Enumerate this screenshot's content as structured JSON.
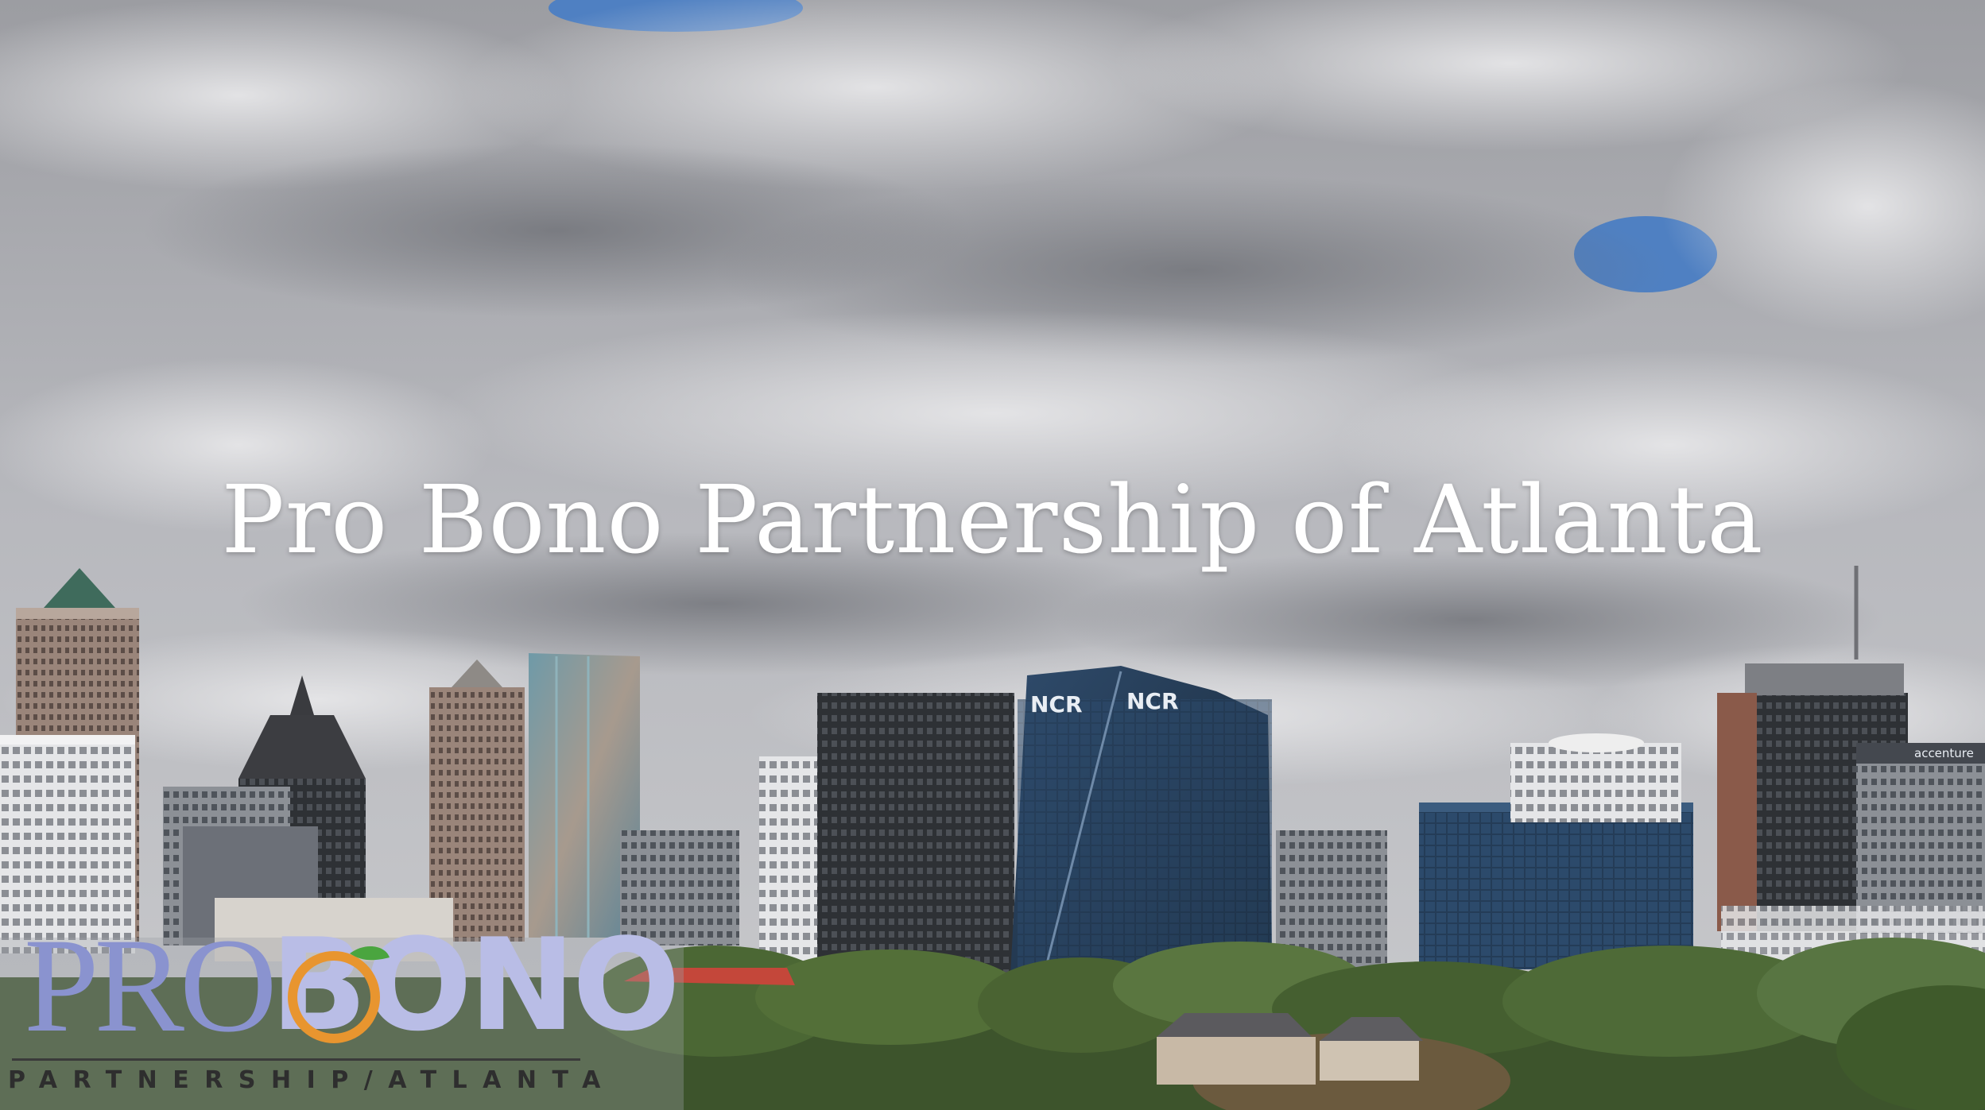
{
  "title": "Pro Bono Partnership of Atlanta",
  "logo": {
    "word_left": "PRO",
    "word_right": "BONO",
    "subtitle": "PARTNERSHIP/ATLANTA"
  },
  "signage": {
    "ncr_left": "NCR",
    "ncr_right": "NCR",
    "accenture": "accenture"
  },
  "colors": {
    "sky": "#b4b5ba",
    "cloud": "#dcdcde",
    "blue_sky": "#4f80c2",
    "glass_tower": "#23384f",
    "trees": "#3f5a2b",
    "logo_pro": "#8a93cf",
    "logo_bono": "#b9bde6",
    "logo_ring": "#e8952f",
    "logo_leaf": "#4aa53f"
  }
}
